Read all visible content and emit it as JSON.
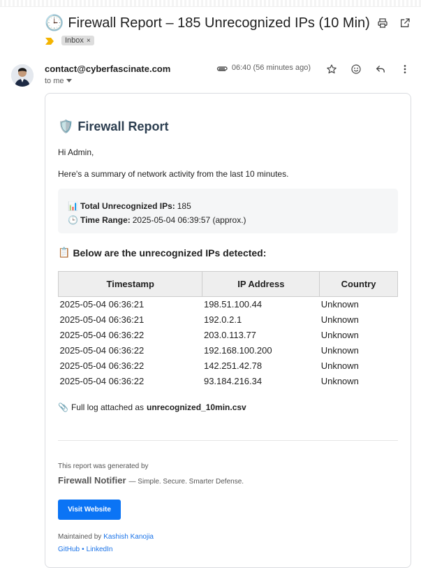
{
  "email": {
    "subject": "Firewall Report – 185 Unrecognized IPs (10 Min)",
    "subject_icon": "🕒",
    "label_chip": "Inbox",
    "label_remove": "×",
    "sender": "contact@cyberfascinate.com",
    "recipient": "to me",
    "time": "06:40 (56 minutes ago)"
  },
  "icons": {
    "top": [
      "print-icon",
      "open-in-new-window-icon"
    ],
    "meta": [
      "attachment-icon",
      "star-icon",
      "emoji-icon",
      "reply-icon",
      "more-vert-icon"
    ]
  },
  "report": {
    "title_icon": "🛡️",
    "title": "Firewall Report",
    "greeting": "Hi Admin,",
    "intro": "Here's a summary of network activity from the last 10 minutes.",
    "total_icon": "📊",
    "total_label": "Total Unrecognized IPs:",
    "total_value": "185",
    "range_icon": "🕒",
    "range_label": "Time Range:",
    "range_value": "2025-05-04 06:39:57 (approx.)",
    "table_icon": "📋",
    "table_heading": "Below are the unrecognized IPs detected:",
    "columns": [
      "Timestamp",
      "IP Address",
      "Country"
    ],
    "rows": [
      [
        "2025-05-04 06:36:21",
        "198.51.100.44",
        "Unknown"
      ],
      [
        "2025-05-04 06:36:21",
        "192.0.2.1",
        "Unknown"
      ],
      [
        "2025-05-04 06:36:22",
        "203.0.113.77",
        "Unknown"
      ],
      [
        "2025-05-04 06:36:22",
        "192.168.100.200",
        "Unknown"
      ],
      [
        "2025-05-04 06:36:22",
        "142.251.42.78",
        "Unknown"
      ],
      [
        "2025-05-04 06:36:22",
        "93.184.216.34",
        "Unknown"
      ]
    ],
    "attach_icon": "📎",
    "attach_text": "Full log attached as",
    "attach_file": "unrecognized_10min.csv"
  },
  "footer": {
    "generated": "This report was generated by",
    "notifier_name": "Firewall Notifier",
    "tagline": "— Simple. Secure. Smarter Defense.",
    "visit_button": "Visit Website",
    "maintained_by": "Maintained by",
    "maintainer": "Kashish Kanojia",
    "github": "GitHub",
    "separator": "•",
    "linkedin": "LinkedIn"
  },
  "colors": {
    "button": "#0b74f5",
    "link": "#1a73e8",
    "title": "#2c3e50",
    "label_marker": "#f4b400"
  }
}
